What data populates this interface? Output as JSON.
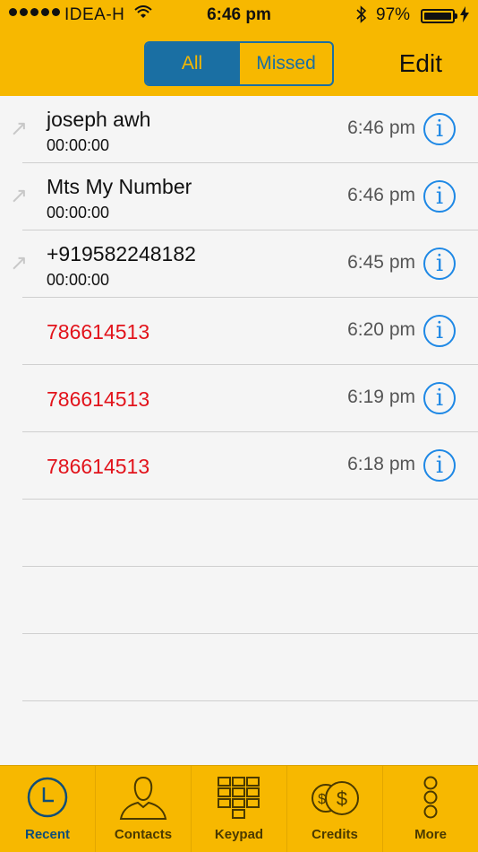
{
  "status": {
    "carrier": "IDEA-H",
    "time": "6:46 pm",
    "battery": "97%"
  },
  "header": {
    "segments": [
      "All",
      "Missed"
    ],
    "active_segment": "All",
    "edit_label": "Edit"
  },
  "calls": [
    {
      "name": "joseph awh",
      "duration": "00:00:00",
      "time": "6:46 pm",
      "type": "outgoing"
    },
    {
      "name": "Mts My Number",
      "duration": "00:00:00",
      "time": "6:46 pm",
      "type": "outgoing"
    },
    {
      "name": "+919582248182",
      "duration": "00:00:00",
      "time": "6:45 pm",
      "type": "outgoing"
    },
    {
      "name": "786614513",
      "time": "6:20 pm",
      "type": "missed"
    },
    {
      "name": "786614513",
      "time": "6:19 pm",
      "type": "missed"
    },
    {
      "name": "786614513",
      "time": "6:18 pm",
      "type": "missed"
    }
  ],
  "tabs": [
    {
      "label": "Recent",
      "icon": "clock-icon"
    },
    {
      "label": "Contacts",
      "icon": "person-icon"
    },
    {
      "label": "Keypad",
      "icon": "keypad-icon"
    },
    {
      "label": "Credits",
      "icon": "coins-icon"
    },
    {
      "label": "More",
      "icon": "more-dots-icon"
    }
  ],
  "active_tab": "Recent",
  "colors": {
    "bar": "#f7b800",
    "accent": "#1a6fa3",
    "missed": "#e2131b",
    "info": "#1e88e5"
  }
}
